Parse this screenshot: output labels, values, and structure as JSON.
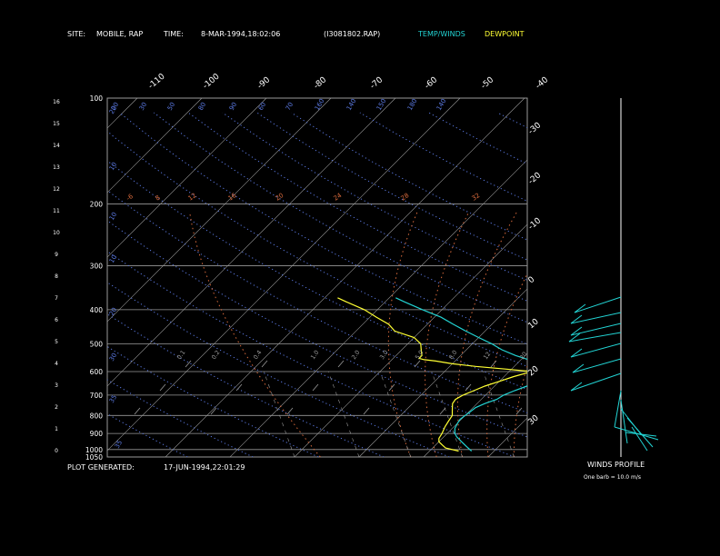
{
  "header": {
    "site_label": "SITE:",
    "site_value": "MOBILE, RAP",
    "time_label": "TIME:",
    "time_value": "8-MAR-1994,18:02:06",
    "file_id": "(I3081802.RAP)",
    "legend_temp": "TEMP/WINDS",
    "legend_dew": "DEWPOINT"
  },
  "footer": {
    "plot_generated_label": "PLOT GENERATED:",
    "plot_generated_value": "17-JUN-1994,22:01:29",
    "winds_profile_label": "WINDS PROFILE",
    "barb_note": "One barb = 10.0 m/s"
  },
  "colors": {
    "temp": "#22d3d3",
    "dew": "#ffff33",
    "grid": "#9a9a9a",
    "mixing": "#5a78e0",
    "adiabat": "#d86a3c",
    "text": "#ffffff"
  },
  "chart_data": {
    "type": "line",
    "pressure_levels": [
      100,
      200,
      300,
      400,
      500,
      600,
      700,
      800,
      900,
      1000,
      1050
    ],
    "height_ticks": [
      0,
      1,
      2,
      3,
      4,
      5,
      6,
      7,
      8,
      9,
      10,
      11,
      12,
      13,
      14,
      15,
      16
    ],
    "temp_labels_top": [
      -110,
      -100,
      -90,
      -80,
      -70,
      -60,
      -50,
      -40
    ],
    "temp_labels_right": [
      -30,
      -20,
      -10,
      0,
      10,
      20,
      30
    ],
    "adiabat_labels": [
      -6,
      8,
      12,
      16,
      20,
      24,
      28,
      32
    ],
    "mixing_labels_lower": [
      "0.1",
      "0.2",
      "0.4",
      "1.0",
      "2.0",
      "3.0",
      "5.0",
      "8.0",
      "12",
      "20"
    ],
    "mixing_labels_left": [
      "20",
      "10",
      "10",
      "10",
      "20",
      "30",
      "35"
    ],
    "mixing_labels_top": [
      "20",
      "30",
      "50",
      "80",
      "90",
      "60",
      "70",
      "160",
      "140",
      "150",
      "180",
      "140"
    ],
    "series": [
      {
        "key": "temp",
        "pressure": [
          1010,
          980,
          950,
          920,
          900,
          870,
          840,
          820,
          800,
          780,
          760,
          740,
          720,
          700,
          680,
          660,
          640,
          620,
          600,
          590,
          580,
          560,
          540,
          520,
          500,
          480,
          460,
          440,
          420,
          400,
          380,
          370
        ],
        "temperature": [
          16.5,
          15,
          13.5,
          12,
          11.2,
          10.4,
          10,
          9.8,
          10,
          10.2,
          10.4,
          11.2,
          12.4,
          12.8,
          13.8,
          15,
          16.2,
          17.2,
          18,
          17.6,
          16,
          12,
          8.5,
          5.5,
          3,
          0,
          -3,
          -6,
          -9,
          -13,
          -17,
          -19
        ]
      },
      {
        "key": "dew",
        "pressure": [
          1010,
          990,
          970,
          950,
          930,
          900,
          860,
          830,
          800,
          780,
          760,
          740,
          720,
          700,
          680,
          660,
          640,
          620,
          600,
          590,
          580,
          570,
          560,
          555,
          550,
          540,
          520,
          500,
          480,
          460,
          440,
          420,
          400,
          380,
          370
        ],
        "temperature": [
          14.5,
          12,
          11,
          10,
          9.5,
          9.2,
          8.6,
          8.3,
          8,
          7.4,
          6.8,
          6.2,
          6,
          6.5,
          7.5,
          8.5,
          10,
          11.5,
          13.5,
          9,
          4,
          0,
          -3,
          -5,
          -6,
          -6,
          -7,
          -8,
          -10,
          -14,
          -16,
          -19,
          -22,
          -26,
          -28
        ]
      }
    ],
    "winds_upper": [
      {
        "y": 327,
        "x1": 632,
        "y1": 344
      },
      {
        "y": 344,
        "x1": 628,
        "y1": 356
      },
      {
        "y": 356,
        "x1": 628,
        "y1": 369
      },
      {
        "y": 366,
        "x1": 626,
        "y1": 376
      },
      {
        "y": 378,
        "x1": 628,
        "y1": 393
      },
      {
        "y": 395,
        "x1": 630,
        "y1": 410
      },
      {
        "y": 411,
        "x1": 628,
        "y1": 430
      }
    ]
  }
}
